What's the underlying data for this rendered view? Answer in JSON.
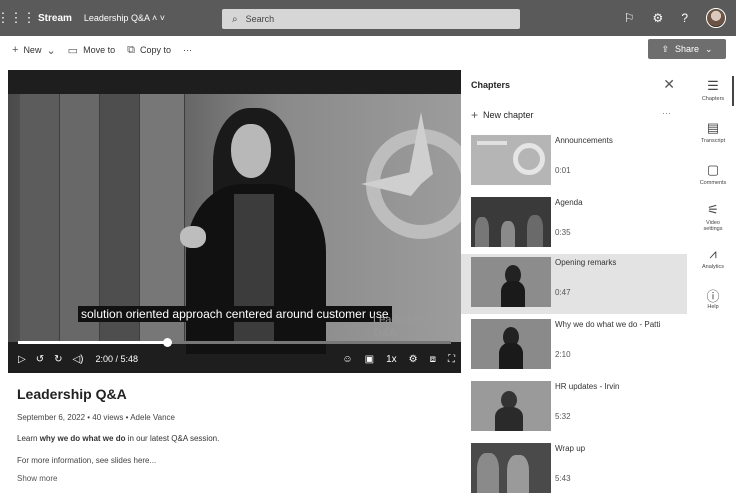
{
  "topbar": {
    "app_name": "Stream",
    "breadcrumb": "Leadership Q&A",
    "search_placeholder": "Search"
  },
  "commands": {
    "new": "New",
    "move_to": "Move to",
    "copy_to": "Copy to",
    "more": "···",
    "share": "Share"
  },
  "player": {
    "caption": "solution oriented approach centered around customer use",
    "watermark_line1": "Leadership",
    "watermark_line2": "Q&A",
    "time": "2:00 / 5:48",
    "speed": "1x",
    "progress": 0.345
  },
  "video": {
    "title": "Leadership Q&A",
    "meta": "September 6, 2022  •  40 views  •  Adele Vance",
    "desc_prefix": "Learn ",
    "desc_bold": "why we do what we do",
    "desc_suffix": " in our latest Q&A session.",
    "info": "For more information, see slides here...",
    "show_more": "Show more"
  },
  "chapters": {
    "heading": "Chapters",
    "new_chapter": "New chapter",
    "more": "···",
    "items": [
      {
        "title": "Announcements",
        "time": "0:01"
      },
      {
        "title": "Agenda",
        "time": "0:35"
      },
      {
        "title": "Opening remarks",
        "time": "0:47"
      },
      {
        "title": "Why we do what we do - Patti",
        "time": "2:10"
      },
      {
        "title": "HR updates - Irvin",
        "time": "5:32"
      },
      {
        "title": "Wrap up",
        "time": "5:43"
      }
    ]
  },
  "rail": [
    {
      "label": "Chapters",
      "icon": "chapters-icon"
    },
    {
      "label": "Transcript",
      "icon": "transcript-icon"
    },
    {
      "label": "Comments",
      "icon": "comments-icon"
    },
    {
      "label": "Video settings",
      "icon": "video-settings-icon"
    },
    {
      "label": "Analytics",
      "icon": "analytics-icon"
    },
    {
      "label": "Help",
      "icon": "help-icon"
    }
  ]
}
